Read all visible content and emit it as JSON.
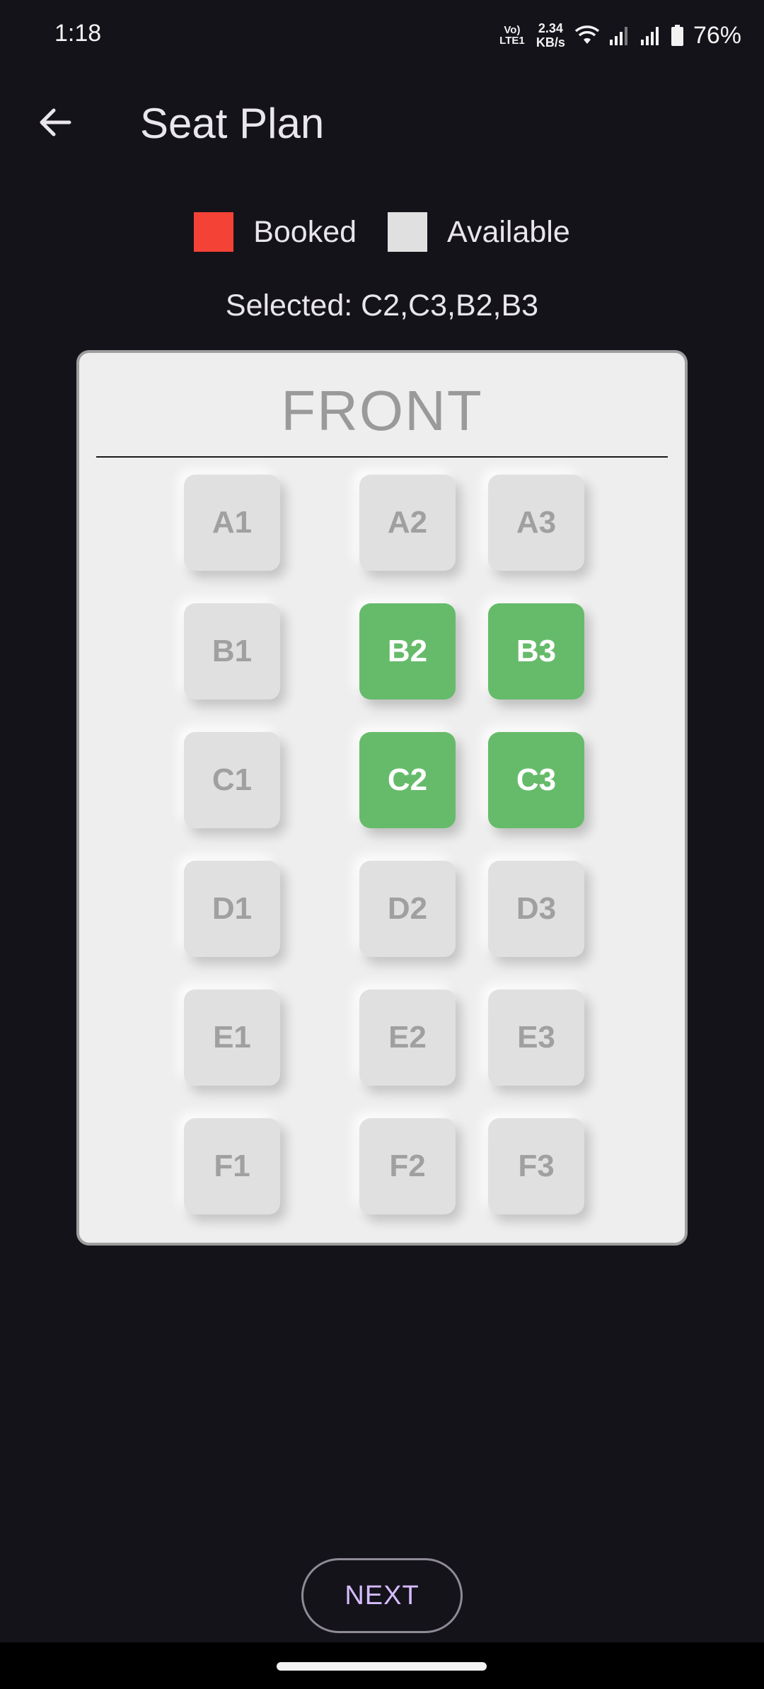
{
  "status_bar": {
    "time": "1:18",
    "volte_line1": "Vo)",
    "volte_line2": "LTE1",
    "net_speed_value": "2.34",
    "net_speed_unit": "KB/s",
    "battery": "76%"
  },
  "app_bar": {
    "title": "Seat Plan",
    "back_icon": "arrow-back-icon"
  },
  "legend": {
    "booked_label": "Booked",
    "booked_color": "#f44336",
    "available_label": "Available",
    "available_color": "#e0e0e0"
  },
  "selection": {
    "text": "Selected: C2,C3,B2,B3"
  },
  "seat_map": {
    "front_label": "FRONT",
    "selected_color": "#66bb6a",
    "rows": [
      {
        "row": "A",
        "seats": [
          {
            "label": "A1",
            "state": "available"
          },
          {
            "label": "A2",
            "state": "available"
          },
          {
            "label": "A3",
            "state": "available"
          }
        ]
      },
      {
        "row": "B",
        "seats": [
          {
            "label": "B1",
            "state": "available"
          },
          {
            "label": "B2",
            "state": "selected"
          },
          {
            "label": "B3",
            "state": "selected"
          }
        ]
      },
      {
        "row": "C",
        "seats": [
          {
            "label": "C1",
            "state": "available"
          },
          {
            "label": "C2",
            "state": "selected"
          },
          {
            "label": "C3",
            "state": "selected"
          }
        ]
      },
      {
        "row": "D",
        "seats": [
          {
            "label": "D1",
            "state": "available"
          },
          {
            "label": "D2",
            "state": "available"
          },
          {
            "label": "D3",
            "state": "available"
          }
        ]
      },
      {
        "row": "E",
        "seats": [
          {
            "label": "E1",
            "state": "available"
          },
          {
            "label": "E2",
            "state": "available"
          },
          {
            "label": "E3",
            "state": "available"
          }
        ]
      },
      {
        "row": "F",
        "seats": [
          {
            "label": "F1",
            "state": "available"
          },
          {
            "label": "F2",
            "state": "available"
          },
          {
            "label": "F3",
            "state": "available"
          }
        ]
      }
    ]
  },
  "footer": {
    "next_label": "NEXT"
  }
}
